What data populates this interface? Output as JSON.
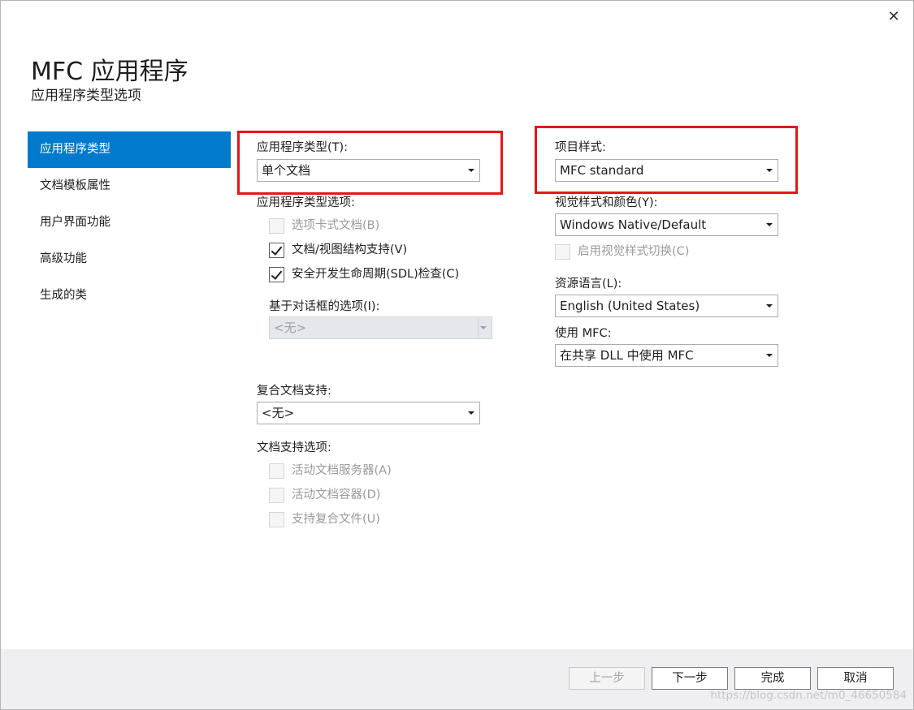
{
  "window": {
    "title": "MFC 应用程序",
    "subtitle": "应用程序类型选项",
    "close_glyph": "✕"
  },
  "nav": {
    "items": [
      {
        "label": "应用程序类型",
        "active": true
      },
      {
        "label": "文档模板属性"
      },
      {
        "label": "用户界面功能"
      },
      {
        "label": "高级功能"
      },
      {
        "label": "生成的类"
      }
    ]
  },
  "app_type": {
    "label": "应用程序类型(T):",
    "value": "单个文档",
    "options_label": "应用程序类型选项:",
    "options": [
      {
        "label": "选项卡式文档(B)",
        "checked": false,
        "enabled": false
      },
      {
        "label": "文档/视图结构支持(V)",
        "checked": true,
        "enabled": true
      },
      {
        "label": "安全开发生命周期(SDL)检查(C)",
        "checked": true,
        "enabled": true
      }
    ],
    "dialog_label": "基于对话框的选项(I):",
    "dialog_value": "<无>"
  },
  "compound": {
    "label": "复合文档支持:",
    "value": "<无>",
    "support_label": "文档支持选项:",
    "options": [
      {
        "label": "活动文档服务器(A)",
        "checked": false,
        "enabled": false
      },
      {
        "label": "活动文档容器(D)",
        "checked": false,
        "enabled": false
      },
      {
        "label": "支持复合文件(U)",
        "checked": false,
        "enabled": false
      }
    ]
  },
  "project_style": {
    "label": "项目样式:",
    "value": "MFC standard"
  },
  "visual_style": {
    "label": "视觉样式和颜色(Y):",
    "value": "Windows Native/Default",
    "toggle_label": "启用视觉样式切换(C)"
  },
  "resource_lang": {
    "label": "资源语言(L):",
    "value": "English (United States)"
  },
  "use_mfc": {
    "label": "使用 MFC:",
    "value": "在共享 DLL 中使用 MFC"
  },
  "footer": {
    "prev": "上一步",
    "next": "下一步",
    "finish": "完成",
    "cancel": "取消",
    "watermark": "https://blog.csdn.net/m0_46650584"
  },
  "colors": {
    "accent": "#007acc",
    "highlight": "#e51717"
  }
}
